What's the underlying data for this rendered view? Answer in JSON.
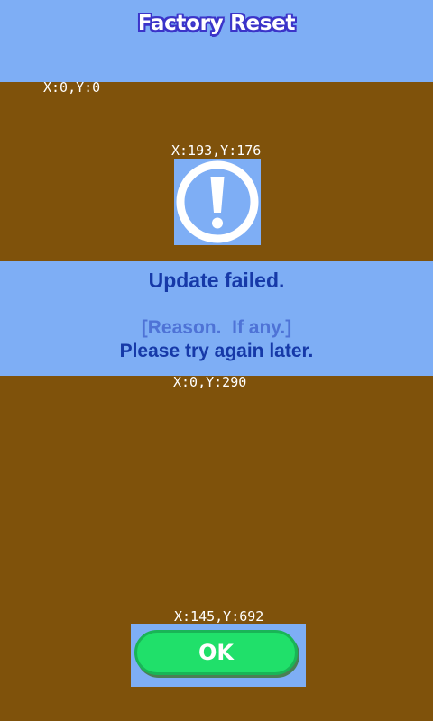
{
  "header": {
    "title": "Factory Reset"
  },
  "coordinate_labels": {
    "origin": "X:0,Y:0",
    "warning_icon": "X:193,Y:176",
    "message": "X:0,Y:290",
    "ok_button": "X:145,Y:692"
  },
  "warning": {
    "icon": "exclamation-circle-icon"
  },
  "message": {
    "headline": "Update failed.",
    "reason": "[Reason.  If any.]",
    "retry": "Please try again later."
  },
  "actions": {
    "ok_label": "OK"
  },
  "colors": {
    "background": "#7f520b",
    "panel": "#7eaef5",
    "headline_text": "#1639a8",
    "reason_text": "#4e73d6",
    "ok_button": "#20e06a",
    "title_outline": "#3b34c9"
  }
}
